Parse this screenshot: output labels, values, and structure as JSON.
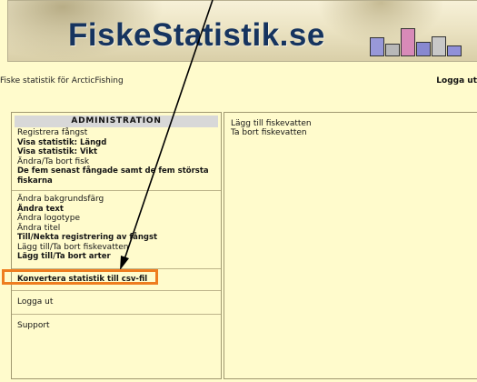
{
  "header": {
    "site_title": "FiskeStatistik.se",
    "subtitle": "Fiske statistik för ArcticFishing",
    "logout_label": "Logga ut"
  },
  "logo_bars": [
    {
      "level": 0.55,
      "color": "#9898d8"
    },
    {
      "level": 0.35,
      "color": "#b8b8b8"
    },
    {
      "level": 0.85,
      "color": "#d88ab8"
    },
    {
      "level": 0.4,
      "color": "#8888d0"
    },
    {
      "level": 0.6,
      "color": "#c8c8c8"
    },
    {
      "level": 0.3,
      "color": "#9090d8"
    }
  ],
  "menu": {
    "header": "ADMINISTRATION",
    "group1": [
      {
        "label": "Registrera fångst",
        "bold": false
      },
      {
        "label": "Visa statistik: Längd",
        "bold": true
      },
      {
        "label": "Visa statistik: Vikt",
        "bold": true
      },
      {
        "label": "Ändra/Ta bort fisk",
        "bold": false
      },
      {
        "label": "De fem senast fångade samt de fem största fiskarna",
        "bold": true
      }
    ],
    "group2": [
      {
        "label": "Ändra bakgrundsfärg",
        "bold": false
      },
      {
        "label": "Ändra text",
        "bold": true
      },
      {
        "label": "Ändra logotype",
        "bold": false
      },
      {
        "label": "Ändra titel",
        "bold": false
      },
      {
        "label": "Till/Nekta registrering av fångst",
        "bold": true
      },
      {
        "label": "Lägg till/Ta bort fiskevatten",
        "bold": false
      },
      {
        "label": "Lägg till/Ta bort arter",
        "bold": true
      }
    ],
    "convert": "Konvertera statistik till csv-fil",
    "logout": "Logga ut",
    "support": "Support"
  },
  "content": {
    "links": [
      "Lägg till fiskevatten",
      "Ta bort fiskevatten"
    ]
  },
  "annotation": {
    "highlight_color": "#ee7d1f",
    "arrow_color": "#000000"
  }
}
